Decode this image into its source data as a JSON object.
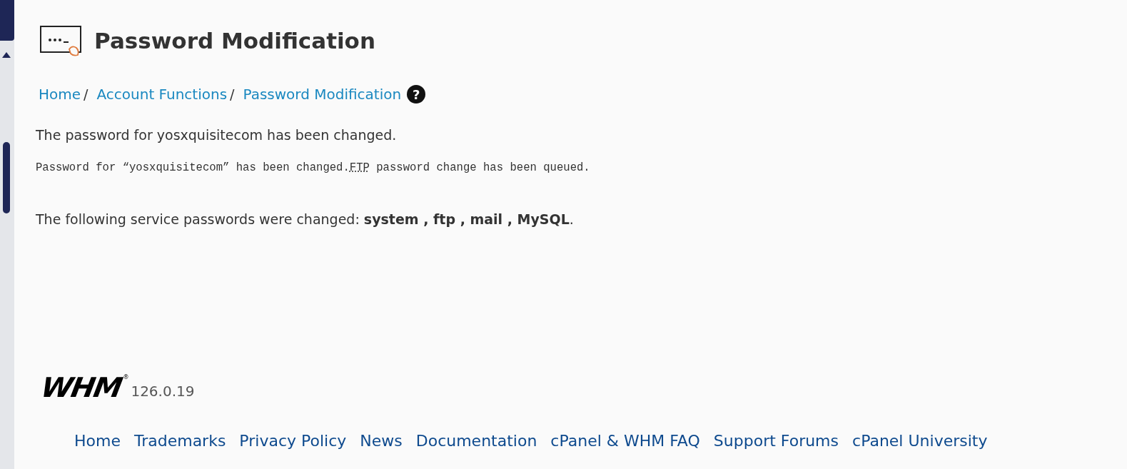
{
  "page": {
    "title": "Password Modification"
  },
  "breadcrumb": [
    {
      "label": "Home",
      "separator": "/"
    },
    {
      "label": "Account Functions",
      "separator": "/"
    },
    {
      "label": "Password Modification"
    }
  ],
  "help": {
    "label": "?"
  },
  "message": "The password for yosxquisitecom has been changed.",
  "log": {
    "before": "Password for “yosxquisitecom” has been changed.",
    "abbr": "FTP",
    "after": " password change has been queued."
  },
  "services": "The following service passwords were changed: **system , ftp , mail , MySQL**.",
  "footer": {
    "logo": "WHM",
    "registered": "®",
    "version": "126.0.19",
    "links": [
      {
        "label": "Home"
      },
      {
        "label": "Trademarks"
      },
      {
        "label": "Privacy Policy"
      },
      {
        "label": "News"
      },
      {
        "label": "Documentation"
      },
      {
        "label": "cPanel & WHM FAQ"
      },
      {
        "label": "Support Forums"
      },
      {
        "label": "cPanel University"
      }
    ]
  }
}
